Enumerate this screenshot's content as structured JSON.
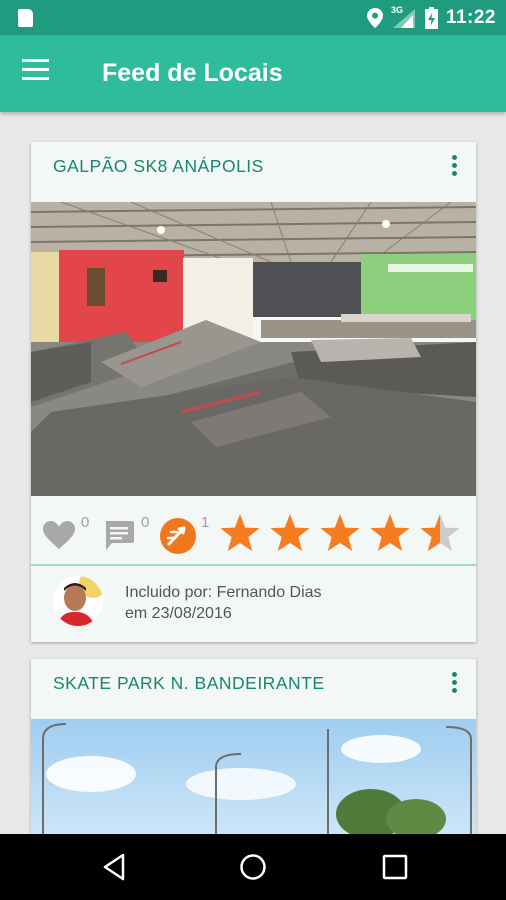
{
  "status_bar": {
    "time": "11:22",
    "network": "3G",
    "icons": [
      "sd-card-icon",
      "location-icon",
      "signal-icon",
      "battery-icon"
    ]
  },
  "app_bar": {
    "title": "Feed de Locais",
    "menu_icon": "menu-icon"
  },
  "feed": {
    "cards": [
      {
        "title": "GALPÃO SK8 ANÁPOLIS",
        "likes": "0",
        "comments": "0",
        "checkins": "1",
        "rating": 4.5,
        "rating_max": 5,
        "author_line": "Incluido por: Fernando Dias",
        "date_line": "em 23/08/2016"
      },
      {
        "title": "SKATE PARK N. BANDEIRANTE"
      }
    ]
  },
  "colors": {
    "status_bar": "#1f9c80",
    "app_bar": "#2fbc9c",
    "accent": "#17876f",
    "star": "#f57c1f",
    "star_empty": "#cccccc",
    "icon_gray": "#a0a0a0"
  },
  "nav_bar": {
    "icons": [
      "back-icon",
      "home-icon",
      "recents-icon"
    ]
  }
}
